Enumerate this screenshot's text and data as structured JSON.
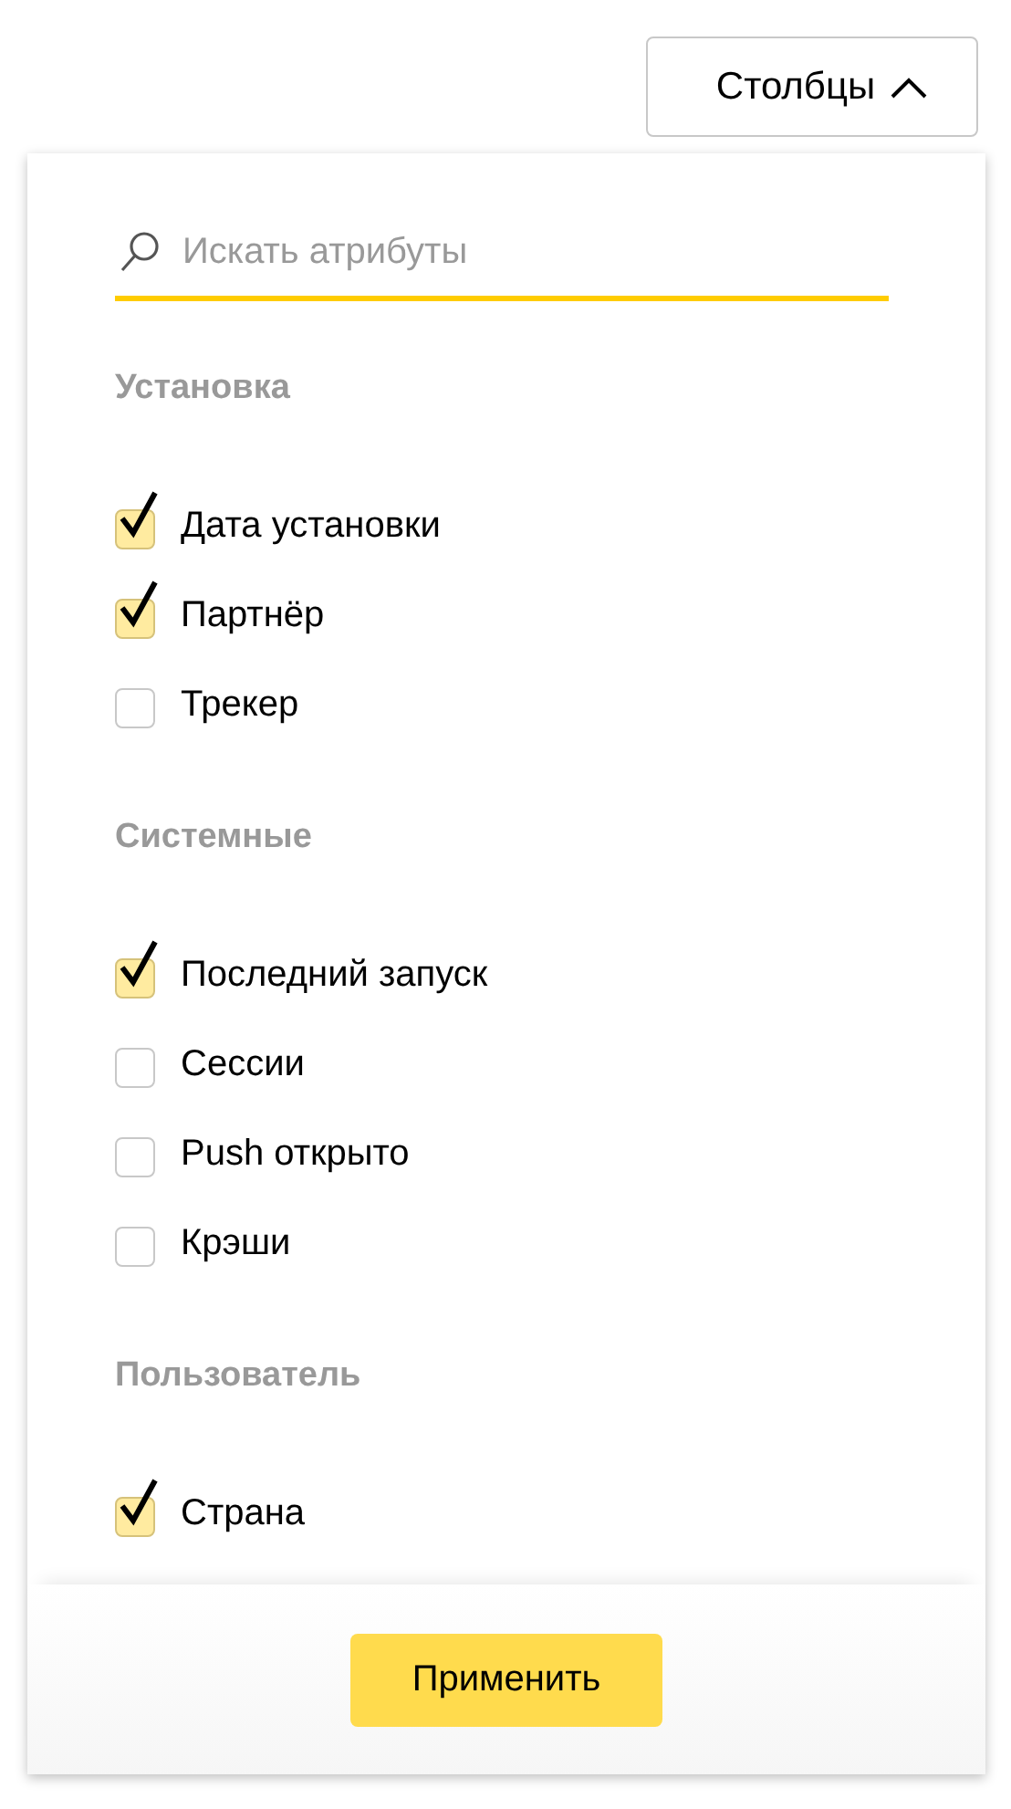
{
  "columns_button": {
    "label": "Столбцы",
    "expanded": true
  },
  "search": {
    "placeholder": "Искать атрибуты"
  },
  "groups": [
    {
      "title": "Установка",
      "items": [
        {
          "label": "Дата установки",
          "checked": true
        },
        {
          "label": "Партнёр",
          "checked": true
        },
        {
          "label": "Трекер",
          "checked": false
        }
      ]
    },
    {
      "title": "Системные",
      "items": [
        {
          "label": "Последний запуск",
          "checked": true
        },
        {
          "label": "Сессии",
          "checked": false
        },
        {
          "label": "Push открыто",
          "checked": false
        },
        {
          "label": "Крэши",
          "checked": false
        }
      ]
    },
    {
      "title": "Пользователь",
      "items": [
        {
          "label": "Страна",
          "checked": true
        }
      ]
    }
  ],
  "apply_button": {
    "label": "Применить"
  }
}
